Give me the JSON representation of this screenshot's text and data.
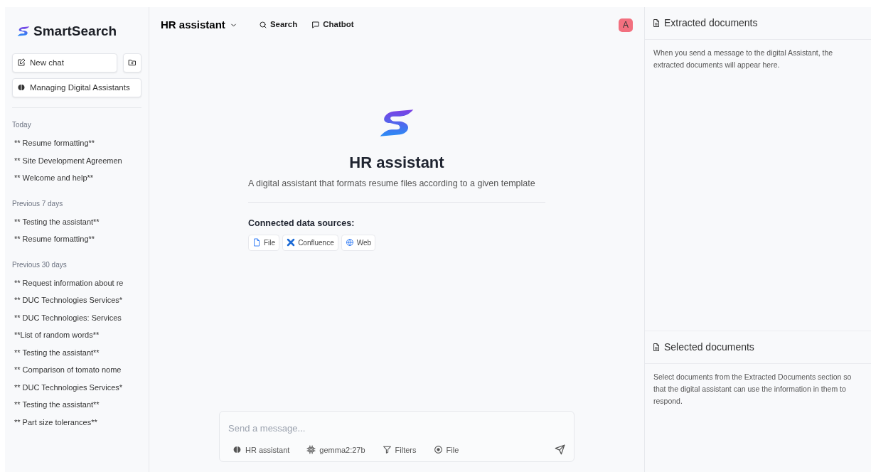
{
  "sidebar": {
    "brand": "SmartSearch",
    "new_chat": "New chat",
    "assistants_button": "Managing Digital Assistants",
    "groups": [
      {
        "label": "Today",
        "items": [
          {
            "label": "** Resume formatting**"
          },
          {
            "label": "** Site Development Agreemen"
          },
          {
            "label": "** Welcome and help**"
          }
        ]
      },
      {
        "label": "Previous 7 days",
        "items": [
          {
            "label": "** Testing the assistant**"
          },
          {
            "label": "** Resume formatting**"
          }
        ]
      },
      {
        "label": "Previous 30 days",
        "items": [
          {
            "label": "** Request information about re"
          },
          {
            "label": "** DUC Technologies Services*"
          },
          {
            "label": "** DUC Technologies: Services"
          },
          {
            "label": "**List of random words**"
          },
          {
            "label": "** Testing the assistant**"
          },
          {
            "label": "** Comparison of tomato nome"
          },
          {
            "label": "** DUC Technologies Services*"
          },
          {
            "label": "** Testing the assistant**"
          },
          {
            "label": "** Part size tolerances**"
          }
        ]
      }
    ]
  },
  "header": {
    "assistant_selector": "HR assistant",
    "nav": [
      {
        "label": "Search",
        "kind": "search"
      },
      {
        "label": "Chatbot",
        "kind": "chat"
      }
    ],
    "avatar": "A"
  },
  "hero": {
    "title": "HR assistant",
    "description": "A digital assistant that formats resume files according to a given template",
    "sources_label": "Connected data sources:",
    "sources": [
      {
        "label": "File",
        "kind": "file"
      },
      {
        "label": "Confluence",
        "kind": "confluence"
      },
      {
        "label": "Web",
        "kind": "web"
      }
    ]
  },
  "composer": {
    "placeholder": "Send a message...",
    "tools": [
      {
        "label": "HR assistant",
        "kind": "brain"
      },
      {
        "label": "gemma2:27b",
        "kind": "chip"
      },
      {
        "label": "Filters",
        "kind": "filter"
      },
      {
        "label": "File",
        "kind": "plus"
      }
    ]
  },
  "panels": [
    {
      "title": "Extracted documents",
      "body": "When you send a message to the digital Assistant, the extracted documents will appear here."
    },
    {
      "title": "Selected documents",
      "body": "Select documents from the Extracted Documents section so that the digital assistant can use the information in them to respond."
    }
  ]
}
